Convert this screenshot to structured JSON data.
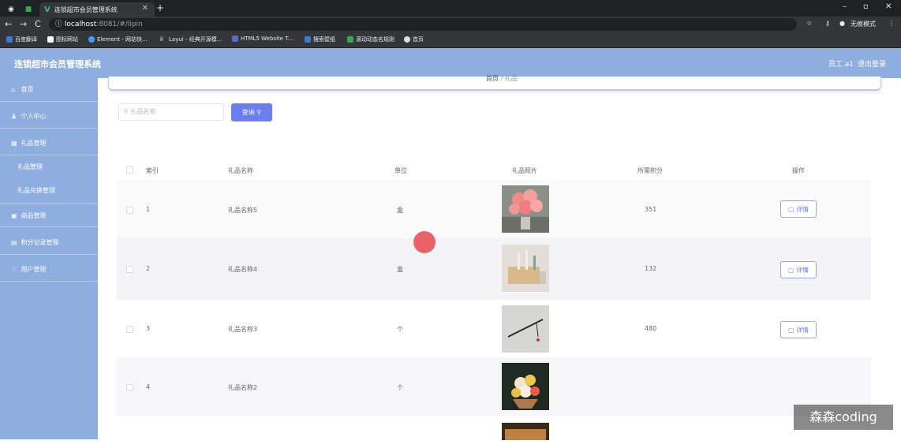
{
  "browser": {
    "tab_title": "连锁超市会员管理系统",
    "url_host": "localhost",
    "url_path": ":8081/#/lipin",
    "incognito_label": "无痕模式",
    "bookmarks": [
      "百度翻译",
      "图标网站",
      "Element - 网站快...",
      "Layui - 经典开源模...",
      "HTML5 Website T...",
      "搜索壁纸",
      "滚动动态名规则",
      "首页"
    ]
  },
  "header": {
    "title": "连锁超市会员管理系统",
    "user": "员工 a1",
    "logout": "退出登录"
  },
  "sidebar": {
    "items": [
      {
        "label": "首页"
      },
      {
        "label": "个人中心"
      },
      {
        "label": "礼品管理"
      },
      {
        "label": "礼品管理"
      },
      {
        "label": "礼品兑换管理"
      },
      {
        "label": "商品管理"
      },
      {
        "label": "积分记录管理"
      },
      {
        "label": "用户管理"
      }
    ]
  },
  "breadcrumb": {
    "home": "首页",
    "sep": "/",
    "current": "礼品"
  },
  "search": {
    "placeholder": "礼品名称",
    "button": "查询"
  },
  "table": {
    "headers": [
      "索引",
      "礼品名称",
      "单位",
      "礼品照片",
      "所需积分",
      "操作"
    ],
    "rows": [
      {
        "index": "1",
        "name": "礼品名称5",
        "unit": "盒",
        "points": "351",
        "action": "详情"
      },
      {
        "index": "2",
        "name": "礼品名称4",
        "unit": "盒",
        "points": "132",
        "action": "详情"
      },
      {
        "index": "3",
        "name": "礼品名称3",
        "unit": "个",
        "points": "480",
        "action": "详情"
      },
      {
        "index": "4",
        "name": "礼品名称2",
        "unit": "个",
        "points": "",
        "action": ""
      }
    ]
  },
  "watermark": "森森coding",
  "colors": {
    "sidebar": "#8eaee0",
    "accent": "#6b7ef0"
  }
}
